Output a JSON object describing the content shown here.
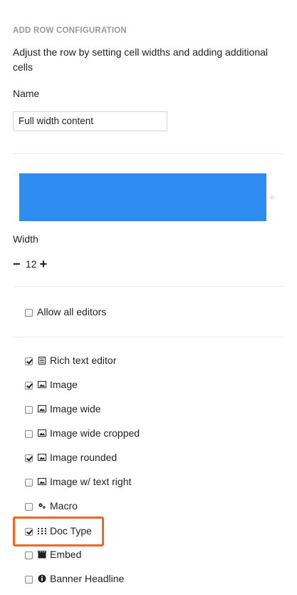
{
  "header": {
    "title": "ADD ROW CONFIGURATION",
    "description": "Adjust the row by setting cell widths and adding additional cells"
  },
  "name_field": {
    "label": "Name",
    "value": "Full width content"
  },
  "cell_preview": {
    "color": "#2f8cf0",
    "add_symbol": "+"
  },
  "width": {
    "label": "Width",
    "value": "12",
    "decrement_symbol": "−",
    "increment_symbol": "+"
  },
  "allow_all": {
    "label": "Allow all editors",
    "checked": false
  },
  "editors": [
    {
      "label": "Rich text editor",
      "icon": "rich-text-icon",
      "checked": true
    },
    {
      "label": "Image",
      "icon": "image-icon",
      "checked": true
    },
    {
      "label": "Image wide",
      "icon": "image-icon",
      "checked": false
    },
    {
      "label": "Image wide cropped",
      "icon": "image-icon",
      "checked": false
    },
    {
      "label": "Image rounded",
      "icon": "image-icon",
      "checked": true
    },
    {
      "label": "Image w/ text right",
      "icon": "image-icon",
      "checked": false
    },
    {
      "label": "Macro",
      "icon": "settings-icon",
      "checked": false
    },
    {
      "label": "Doc Type",
      "icon": "grid-icon",
      "checked": true
    },
    {
      "label": "Embed",
      "icon": "movie-icon",
      "checked": false
    },
    {
      "label": "Banner Headline",
      "icon": "info-icon",
      "checked": false
    }
  ],
  "highlight_color": "#f26522"
}
